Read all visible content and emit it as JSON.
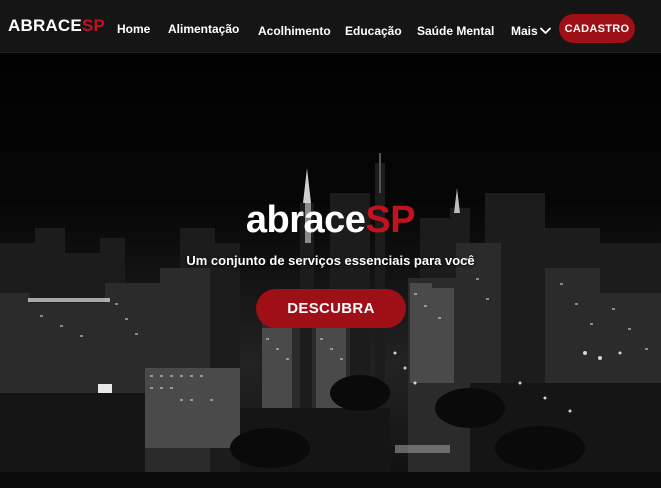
{
  "brand": {
    "logo_part1": "ABRACE",
    "logo_part2": "SP",
    "accent_color": "#c1121f"
  },
  "nav": {
    "items": [
      {
        "label": "Home"
      },
      {
        "label": "Alimentação"
      },
      {
        "label": "Acolhimento"
      },
      {
        "label": "Educação"
      },
      {
        "label": "Saúde Mental"
      }
    ],
    "more_label": "Mais",
    "more_icon": "chevron-down-icon",
    "cta_label": "CADASTRO"
  },
  "hero": {
    "title_part1": "abrace",
    "title_part2": "SP",
    "subtitle": "Um conjunto de serviços essenciais para você",
    "button_label": "DESCUBRA",
    "background": "night-city-skyline"
  }
}
